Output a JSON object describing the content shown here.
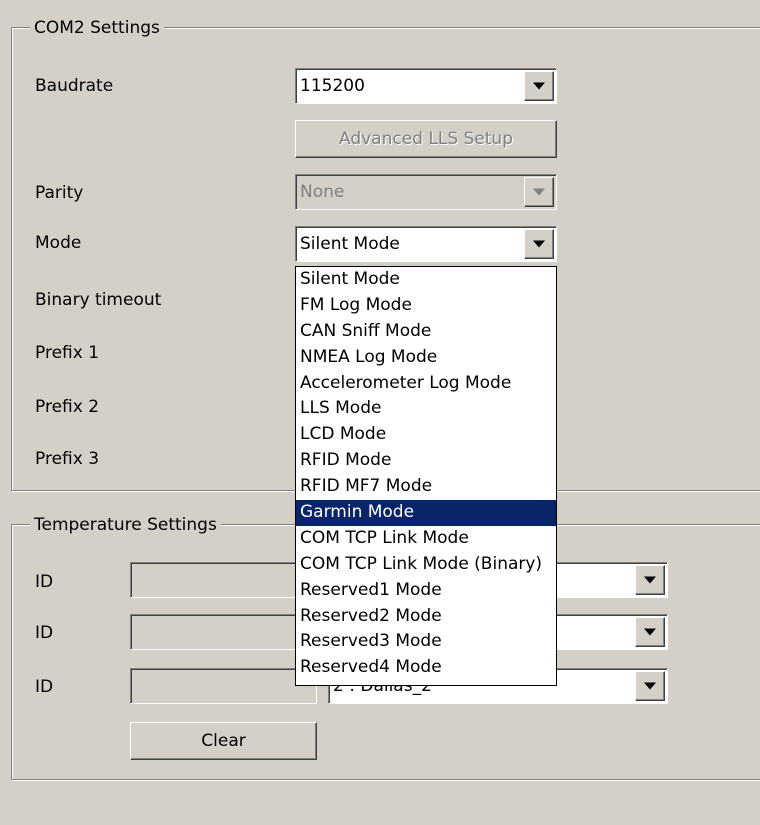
{
  "com2": {
    "title": "COM2 Settings",
    "baudrate_label": "Baudrate",
    "baudrate_value": "115200",
    "advanced_button": "Advanced LLS Setup",
    "parity_label": "Parity",
    "parity_value": "None",
    "mode_label": "Mode",
    "mode_value": "Silent Mode",
    "binary_timeout_label": "Binary timeout",
    "prefix1_label": "Prefix 1",
    "prefix2_label": "Prefix 2",
    "prefix3_label": "Prefix 3"
  },
  "mode_options": [
    "Silent Mode",
    "FM Log Mode",
    "CAN Sniff Mode",
    "NMEA Log Mode",
    "Accelerometer Log Mode",
    "LLS Mode",
    "LCD Mode",
    "RFID Mode",
    "RFID MF7 Mode",
    "Garmin Mode",
    "COM TCP Link Mode",
    "COM TCP Link Mode (Binary)",
    "Reserved1 Mode",
    "Reserved2 Mode",
    "Reserved3 Mode",
    "Reserved4 Mode"
  ],
  "mode_selected_index": 9,
  "temperature": {
    "title": "Temperature Settings",
    "id_label": "ID",
    "row3_sensor_value": "2 : Dallas_2",
    "clear_button": "Clear"
  },
  "colors": {
    "dialog_bg": "#d4d0c8",
    "selection_bg": "#0a246a",
    "selection_fg": "#ffffff",
    "disabled_text": "#808080"
  },
  "icons": {
    "dropdown_arrow": "down-arrow-icon"
  }
}
